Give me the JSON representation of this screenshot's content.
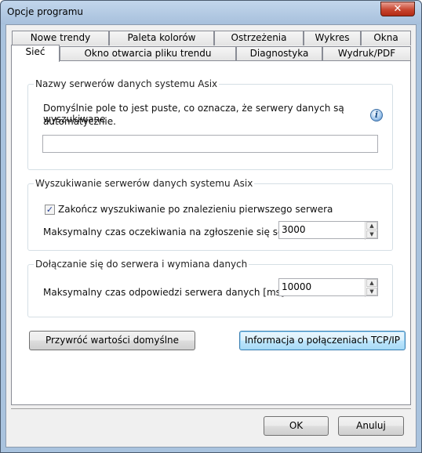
{
  "window": {
    "title": "Opcje programu",
    "close_glyph": "✕"
  },
  "tabs": {
    "row1": [
      "Nowe trendy",
      "Paleta kolorów",
      "Ostrzeżenia",
      "Wykres",
      "Okna"
    ],
    "row2": [
      "Sieć",
      "Okno otwarcia pliku trendu",
      "Diagnostyka",
      "Wydruk/PDF"
    ],
    "active": "Sieć"
  },
  "group_servers": {
    "title": "Nazwy serwerów danych systemu Asix",
    "description_line1": "Domyślnie pole to jest puste, co oznacza, że serwery danych są wyszukiwane",
    "description_line2": "automatycznie.",
    "input_value": "",
    "info_icon": "info-icon"
  },
  "group_search": {
    "title": "Wyszukiwanie serwerów danych systemu Asix",
    "checkbox_label": "Zakończ wyszukiwanie po znalezieniu pierwszego serwera",
    "checkbox_checked": true,
    "timeout_label": "Maksymalny czas oczekiwania na zgłoszenie się serwera [",
    "timeout_value": "3000"
  },
  "group_connect": {
    "title": "Dołączanie się do serwera i wymiana danych",
    "response_label": "Maksymalny czas odpowiedzi serwera danych [ms]",
    "response_value": "10000"
  },
  "buttons": {
    "restore_defaults": "Przywróć wartości domyślne",
    "tcp_info": "Informacja o połączeniach TCP/IP",
    "ok": "OK",
    "cancel": "Anuluj"
  }
}
